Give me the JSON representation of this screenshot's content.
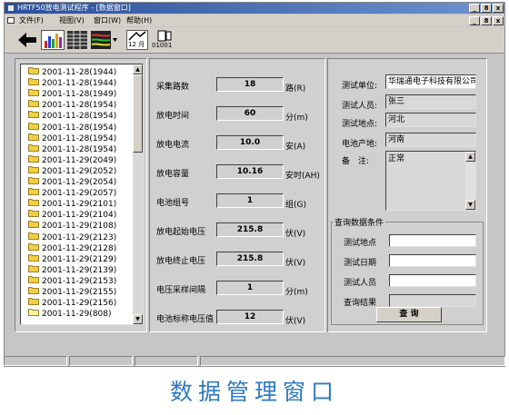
{
  "window": {
    "title": "HRTF50放电测试程序 - [数据窗口]",
    "controls": [
      "_",
      "8",
      "x"
    ]
  },
  "menu": {
    "items": [
      "文件(F)",
      "视图(V)",
      "窗口(W)",
      "帮助(H)"
    ],
    "doc_controls": [
      "_",
      "8",
      "x"
    ]
  },
  "toolbar": {
    "buttons": [
      {
        "icon": "back-arrow-icon"
      },
      {
        "icon": "bar-chart-icon"
      },
      {
        "icon": "grid-report-icon"
      },
      {
        "icon": "curve-chart-icon"
      },
      {
        "icon": "calendar-icon",
        "label": "12 月"
      },
      {
        "icon": "binary-data-icon",
        "label": "01001"
      }
    ]
  },
  "tree": {
    "items": [
      "2001-11-28(1944)",
      "2001-11-28(1944)",
      "2001-11-28(1949)",
      "2001-11-28(1954)",
      "2001-11-28(1954)",
      "2001-11-28(1954)",
      "2001-11-28(1954)",
      "2001-11-28(1954)",
      "2001-11-29(2049)",
      "2001-11-29(2052)",
      "2001-11-29(2054)",
      "2001-11-29(2057)",
      "2001-11-29(2101)",
      "2001-11-29(2104)",
      "2001-11-29(2108)",
      "2001-11-29(2123)",
      "2001-11-29(2128)",
      "2001-11-29(2129)",
      "2001-11-29(2139)",
      "2001-11-29(2153)",
      "2001-11-29(2155)",
      "2001-11-29(2156)",
      "2001-11-29(808)"
    ],
    "selected_index": 22
  },
  "params": [
    {
      "label": "采集路数",
      "value": "18",
      "unit": "路(R)"
    },
    {
      "label": "放电时间",
      "value": "60",
      "unit": "分(m)"
    },
    {
      "label": "放电电流",
      "value": "10.0",
      "unit": "安(A)"
    },
    {
      "label": "放电容量",
      "value": "10.16",
      "unit": "安时(AH)"
    },
    {
      "label": "电池组号",
      "value": "1",
      "unit": "组(G)"
    },
    {
      "label": "放电起始电压",
      "value": "215.8",
      "unit": "伏(V)"
    },
    {
      "label": "放电终止电压",
      "value": "215.8",
      "unit": "伏(V)"
    },
    {
      "label": "电压采样间隔",
      "value": "1",
      "unit": "分(m)"
    },
    {
      "label": "电池标称电压值",
      "value": "12",
      "unit": "伏(V)"
    }
  ],
  "info": {
    "unit_label": "测试单位:",
    "unit_value": "华瑞通电子科技有限公司",
    "person_label": "测试人员:",
    "person_value": "张三",
    "place_label": "测试地点:",
    "place_value": "河北",
    "origin_label": "电池产地:",
    "origin_value": "河南",
    "remark_label": "备　注:",
    "remark_value": "正常"
  },
  "query": {
    "title": "查询数据条件",
    "fields": [
      {
        "label": "测试地点",
        "value": ""
      },
      {
        "label": "测试日期",
        "value": ""
      },
      {
        "label": "测试人员",
        "value": ""
      },
      {
        "label": "查询结果",
        "value": ""
      }
    ],
    "button": "查 询"
  },
  "caption": "数据管理窗口"
}
